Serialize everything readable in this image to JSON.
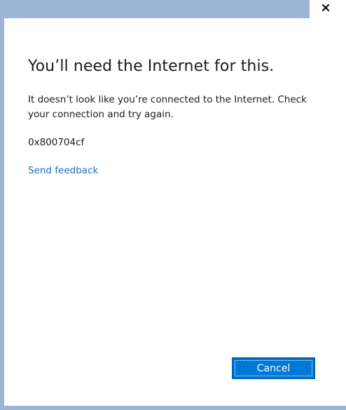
{
  "window": {
    "close_glyph": "x-icon"
  },
  "dialog": {
    "title": "You’ll need the Internet for this.",
    "message": "It doesn’t look like you’re connected to the Internet. Check your connection and try again.",
    "error_code": "0x800704cf",
    "feedback_link": "Send feedback",
    "cancel_label": "Cancel"
  },
  "colors": {
    "background": "#9cb4d3",
    "accent": "#0078d7",
    "link": "#1a6fc2",
    "text": "#1a1a1a"
  }
}
